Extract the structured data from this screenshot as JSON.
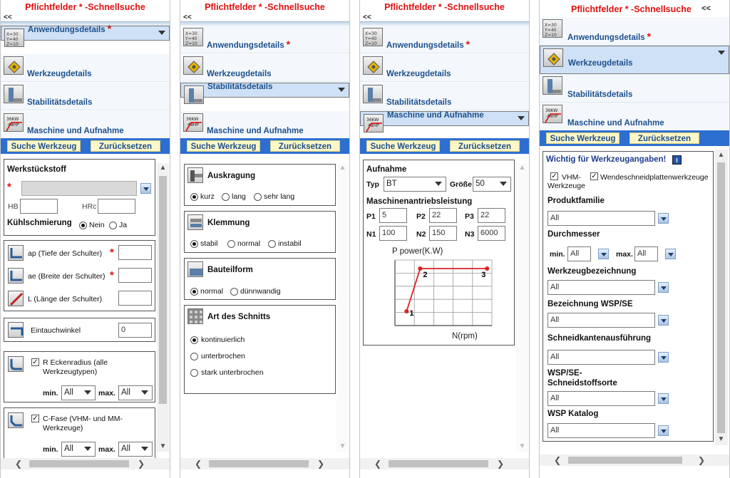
{
  "title": "Pflichtfelder * -Schnellsuche",
  "collapse": "<<",
  "nav": {
    "anwendung": "Anwendungsdetails",
    "werkzeug": "Werkzeugdetails",
    "stabilitaet": "Stabilitätsdetails",
    "maschine": "Maschine und Aufnahme",
    "asterisk": "*"
  },
  "buttons": {
    "suche": "Suche Werkzeug",
    "reset": "Zurücksetzen"
  },
  "p1": {
    "werkstueckstoff": "Werkstückstoff",
    "hb": "HB",
    "hrc": "HRc",
    "kuehl": "Kühlschmierung",
    "nein": "Nein",
    "ja": "Ja",
    "ap": "ap (Tiefe der Schulter)",
    "ae": "ae (Breite der Schulter)",
    "l": "L (Länge der Schulter)",
    "eintauch": "Eintauchwinkel",
    "eintauch_val": "0",
    "radius": "R Eckenradius (alle Werkzeugtypen)",
    "fase": "C-Fase (VHM- und MM-Werkzeuge)",
    "min": "min.",
    "max": "max.",
    "all": "All"
  },
  "p2": {
    "auskragung": "Auskragung",
    "kurz": "kurz",
    "lang": "lang",
    "sehrlang": "sehr lang",
    "klemmung": "Klemmung",
    "stabil": "stabil",
    "normal": "normal",
    "instabil": "instabil",
    "bauteil": "Bauteilform",
    "normal2": "normal",
    "duenn": "dünnwandig",
    "schnitt": "Art des Schnitts",
    "kont": "kontinuierlich",
    "unter": "unterbrochen",
    "stark": "stark unterbrochen"
  },
  "p3": {
    "aufnahme": "Aufnahme",
    "typ": "Typ",
    "typ_val": "BT",
    "groesse": "Größe",
    "groesse_val": "50",
    "leistung": "Maschinenantriebsleistung",
    "p1": "P1",
    "p1v": "5",
    "p2": "P2",
    "p2v": "22",
    "p3": "P3",
    "p3v": "22",
    "n1": "N1",
    "n1v": "100",
    "n2": "N2",
    "n2v": "150",
    "n3": "N3",
    "n3v": "6000",
    "ylabel": "P power(K.W)",
    "xlabel": "N(rpm)",
    "pt1": "1",
    "pt2": "2",
    "pt3": "3"
  },
  "p4": {
    "wichtig": "Wichtig für Werkzeugangaben!",
    "vhm": "VHM-Werkzeuge",
    "wsp": "Wendeschneidplattenwerkzeuge",
    "produktfamilie": "Produktfamilie",
    "durchmesser": "Durchmesser",
    "werkzeugbez": "Werkzeugbezeichnung",
    "bezwsp": "Bezeichnung WSP/SE",
    "schneidkante": "Schneidkantenausführung",
    "schneidstoff": "WSP/SE-Schneidstoffsorte",
    "katalog": "WSP Katalog",
    "min": "min.",
    "max": "max.",
    "all": "All"
  },
  "chart_data": {
    "type": "line",
    "x": [
      1,
      2,
      3
    ],
    "y": [
      1,
      4,
      4
    ],
    "point_labels": [
      "1",
      "2",
      "3"
    ],
    "xlabel": "N(rpm)",
    "ylabel": "P power(K.W)"
  }
}
